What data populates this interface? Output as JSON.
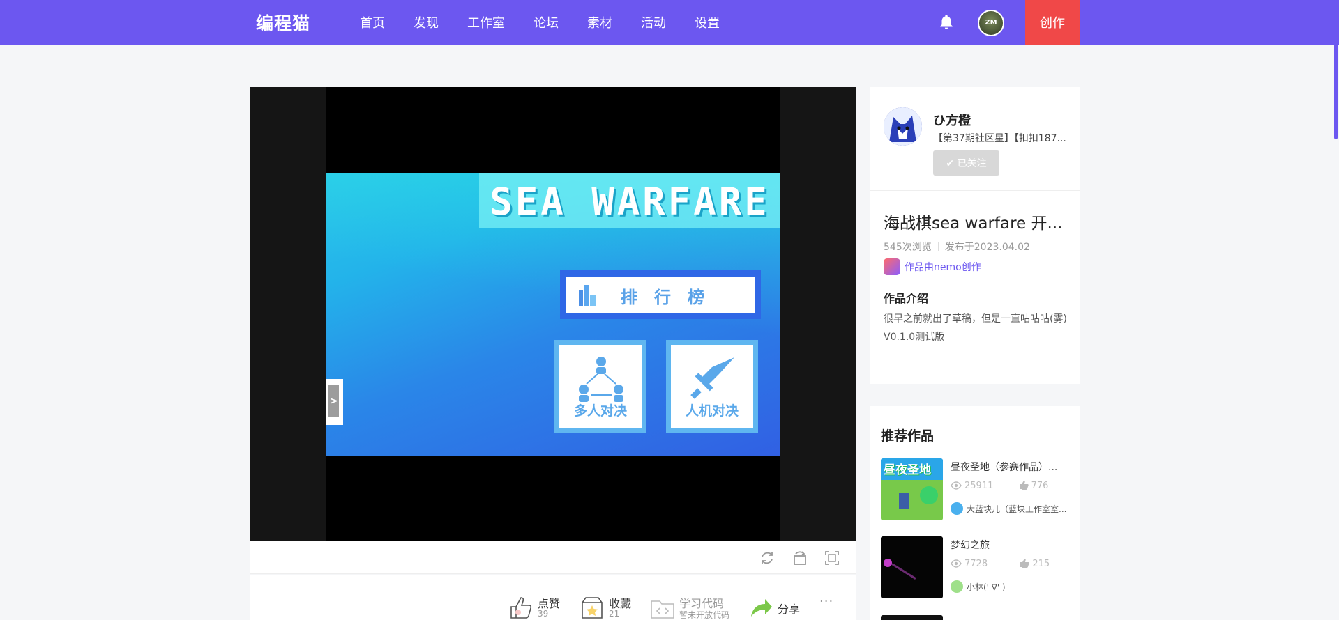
{
  "header": {
    "logo": "编程猫",
    "nav": [
      "首页",
      "发现",
      "工作室",
      "论坛",
      "素材",
      "活动",
      "设置"
    ],
    "create_label": "创作",
    "avatar_text": "ZM"
  },
  "game": {
    "title": "SEA WARFARE",
    "rank_label": "排行榜",
    "mode_multi": "多人对决",
    "mode_ai": "人机对决",
    "side_tab": ">"
  },
  "actions": {
    "like_label": "点赞",
    "like_count": "39",
    "fav_label": "收藏",
    "fav_count": "21",
    "code_label": "学习代码",
    "code_sub": "暂未开放代码",
    "share_label": "分享",
    "more": "···"
  },
  "author": {
    "name": "ひ方橙",
    "badge": "【第37期社区星】【扣扣187...",
    "follow_label": "✔ 已关注"
  },
  "work": {
    "title": "海战棋sea warfare 开...",
    "views": "545次浏览",
    "published": "发布于2023.04.02",
    "made_by": "作品由nemo创作",
    "intro_heading": "作品介绍",
    "intro_lines": [
      "很早之前就出了草稿，但是一直咕咕咕(雾)",
      "V0.1.0测试版"
    ]
  },
  "recommend": {
    "heading": "推荐作品",
    "items": [
      {
        "title": "昼夜圣地（参赛作品）...",
        "views": "25911",
        "likes": "776",
        "author": "大蓝块儿（蓝块工作室室...",
        "thumb_text": "昼夜圣地"
      },
      {
        "title": "梦幻之旅",
        "views": "7728",
        "likes": "215",
        "author": "小林(' ∇' )"
      }
    ]
  },
  "colors": {
    "brand": "#6c57f0",
    "create": "#f04848"
  }
}
